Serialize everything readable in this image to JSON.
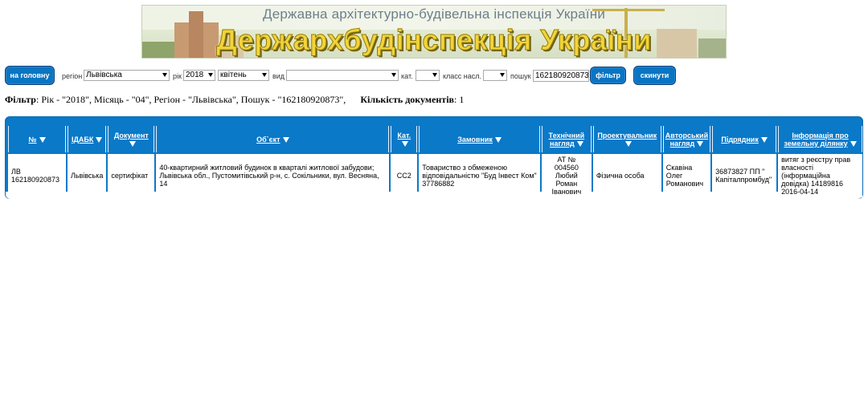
{
  "banner": {
    "line1": "Державна архітектурно-будівельна інспекція України",
    "line2": "Держархбудінспекція України"
  },
  "toolbar": {
    "home_label": "на головну",
    "region_label": "регіон",
    "region_value": "Львівська",
    "year_label": "рік",
    "year_value": "2018",
    "month_value": "квітень",
    "type_label": "вид",
    "type_value": "",
    "cat_label": "кат.",
    "cat_value": "",
    "class_label": "класс насл.",
    "class_value": "",
    "search_label": "пошук",
    "search_value": "162180920873",
    "filter_label": "фільтр",
    "reset_label": "скинути"
  },
  "summary": {
    "filter_word": "Фільтр",
    "filter_text": ": Рік - \"2018\", Місяць - \"04\", Регіон - \"Львівська\", Пошук - \"162180920873\",",
    "count_word": "Кількість документів",
    "count_text": ": 1"
  },
  "table": {
    "columns": [
      "№",
      "ІДАБК",
      "Документ",
      "Об`єкт",
      "Кат.",
      "Замовник",
      "Технічний нагляд",
      "Проектувальник",
      "Авторський нагляд",
      "Підрядник",
      "Інформація про земельну ділянку"
    ],
    "rows": [
      {
        "num": "ЛВ 162180920873",
        "idabk": "Львівська",
        "doc": "сертифікат",
        "object": "40-квартирний житловий будинок в кварталі житлової забудови; Львівська обл., Пустомитівський р-н, с. Сокільники, вул. Весняна, 14",
        "cat": "СС2",
        "customer": "Товариство з обмеженою відповідальністю \"Буд Інвест Ком\" 37786882",
        "tech": "АТ № 004560 Любий Роман Іванович",
        "designer": "Фізична особа",
        "author": "Скавіна Олег Романович",
        "contractor": "36873827 ПП \" Капіталпромбуд\"",
        "land": "витяг з реєстру прав власності (інформаційна довідка) 14189816 2016-04-14"
      }
    ]
  },
  "colors": {
    "accent": "#0a79c8",
    "button": "#0a75c2"
  }
}
